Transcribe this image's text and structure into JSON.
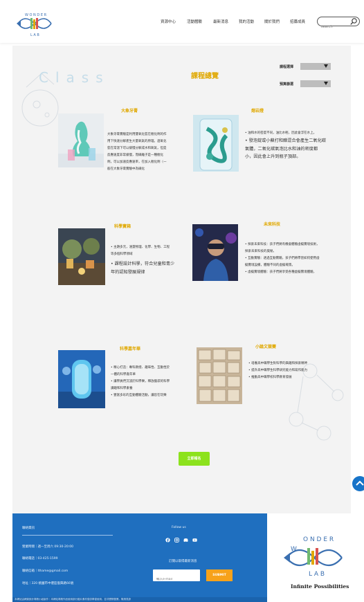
{
  "header": {
    "nav": [
      "資源中心",
      "活動體驗",
      "最新消息",
      "我的活動",
      "關於我們",
      "招募成員"
    ],
    "search_placeholder": "search",
    "logo_letters": [
      "W",
      "O",
      "N",
      "D",
      "E",
      "R",
      "L",
      "A",
      "B"
    ]
  },
  "main": {
    "bg_word": "Class",
    "title": "課程總覽",
    "filters": [
      {
        "label": "課程選擇",
        "value": ""
      },
      {
        "label": "預算篩選",
        "value": ""
      }
    ],
    "courses": [
      {
        "title": "大象牙膏",
        "lines": [
          "大象牙膏實驗是利用雙氧化氫在催化劑的作",
          "用下快速分解產生大量氧氣的原理。過氧化",
          "氫在常溫下可以緩慢分解成水和氧氣，但是",
          "反應速度非常緩慢，而碘離子是一種催化",
          "劑，可以加速反應速率，在加入催化劑（一",
          "般在大象牙膏實驗中為碘化"
        ]
      },
      {
        "title": "熔岩燈",
        "lines": [
          "• 油和水的密度不同，油比水輕，因此會浮在水上。",
          "• 發泡錠或小蘇打和醋混合會產生二氧化碳",
          "氣體，二氧化碳氣泡比水和油的密度都",
          "小，因此會上升到瓶子頂部。"
        ]
      },
      {
        "title": "科學寶箱",
        "lines": [
          "• 主題多元，涵蓋物理、化學、生物、工程",
          "等多個科學領域",
          "• 課程設計科學，符合兒童和青少",
          "年的認知發展規律"
        ]
      },
      {
        "title": "未來科技",
        "lines": [
          "• 探索未來科技：孩子們將有機會體驗虛擬實境技術，",
          "探索未來科技的奧秘。",
          "• 互動實驗：透過互動實驗，孩子們將學習如何使用虛",
          "擬實境設備，體驗不同的虛擬場景。",
          "• 虛擬實境體驗：孩子們將享受各種虛擬實境體驗，"
        ]
      },
      {
        "title": "科學嘉年華",
        "lines": [
          "• 精心打造：專科教授、趣味性、互動性於",
          "一體的科學嘉年華",
          "• 讓學員們沉浸於科學樂，釋放腦袋的科學",
          "讀趣和科學素養",
          "• 豐富多彩的互動體驗活動，讓您在玩樂"
        ]
      },
      {
        "title": "小論文競賽",
        "lines": [
          "• 培養高中職學生對科學的興趣和探索精神",
          "• 提升高中職學生科學研究能力和寫作能力",
          "• 推動高中職學校科學教育發展"
        ]
      }
    ],
    "more_button": "立即報名"
  },
  "footer": {
    "contact_title": "聯絡資訊",
    "contact_lines": [
      "營業時間｜週一至周六 09:30-20:00",
      "聯絡電話｜03-425-1599",
      "聯絡信箱｜lthame@gmail.com",
      "地址｜320 桃園市中壢區復興路66號"
    ],
    "follow_title": "Follow us",
    "subscribe_title": "訂閱以取得最新消息",
    "email_placeholder": "輸入e-mail",
    "submit_label": "SUBMIT",
    "copyright": "本網站由網頁設計專題小組製作｜本網站專題作品使用部分圖片素材僅供學習使用，並非實際營業。敬請見諒",
    "slogan": "Infinite Possibilities"
  },
  "colors": {
    "accent": "#e0a800",
    "footer": "#1f6fbf",
    "button": "#8ce21d",
    "submit": "#f7a21a"
  }
}
